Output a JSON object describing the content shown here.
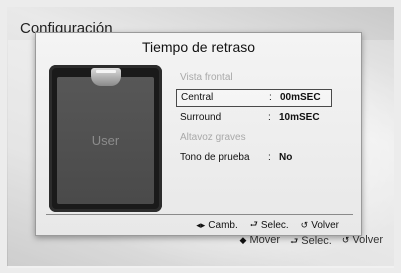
{
  "background": {
    "title": "Configuración",
    "footer": [
      {
        "icon": "nav-arrows-icon",
        "glyph": "◆",
        "label": "Mover"
      },
      {
        "icon": "enter-icon",
        "glyph": "⮐",
        "label": "Selec."
      },
      {
        "icon": "return-icon",
        "glyph": "↺",
        "label": "Volver"
      }
    ]
  },
  "dialog": {
    "title": "Tiempo de retraso",
    "device_label": "User",
    "rows": [
      {
        "label": "Vista frontal",
        "sep": "",
        "value": "",
        "enabled": false,
        "selected": false
      },
      {
        "label": "Central",
        "sep": ":",
        "value": "00mSEC",
        "enabled": true,
        "selected": true
      },
      {
        "label": "Surround",
        "sep": ":",
        "value": "10mSEC",
        "enabled": true,
        "selected": false
      },
      {
        "label": "Altavoz graves",
        "sep": "",
        "value": "",
        "enabled": false,
        "selected": false
      },
      {
        "label": "Tono de prueba",
        "sep": ":",
        "value": "No",
        "enabled": true,
        "selected": false
      }
    ],
    "footer": [
      {
        "icon": "left-right-arrows-icon",
        "glyph": "◂▸",
        "label": "Camb."
      },
      {
        "icon": "enter-icon",
        "glyph": "⮐",
        "label": "Selec."
      },
      {
        "icon": "return-icon",
        "glyph": "↺",
        "label": "Volver"
      }
    ]
  }
}
